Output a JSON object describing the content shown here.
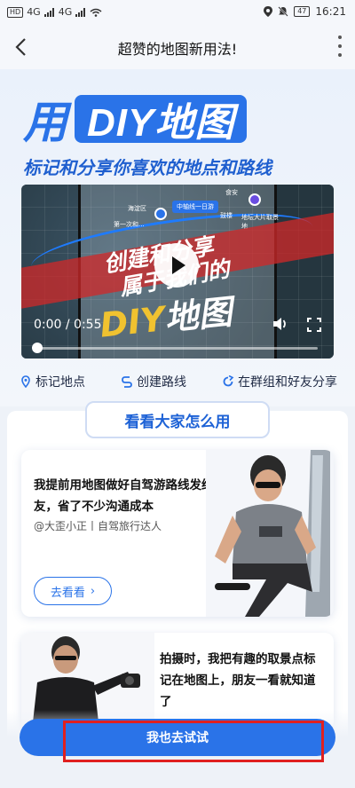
{
  "status_bar": {
    "hd": "HD",
    "net1": "4G",
    "net2": "4G",
    "battery": "47",
    "time": "16:21"
  },
  "nav": {
    "title": "超赞的地图新用法!"
  },
  "hero": {
    "title_prefix": "用",
    "title_main": "DIY地图",
    "subtitle": "标记和分享你喜欢的地点和路线"
  },
  "video": {
    "overlay_line1": "创建和分享",
    "overlay_line2": "属于我们的",
    "overlay_line3_a": "DIY",
    "overlay_line3_b": "地图",
    "map_tag": "中轴线一日游",
    "map_labels": [
      "海淀区",
      "第一次和...",
      "鼓楼",
      "食安",
      "地坛大片取景地"
    ],
    "time": "0:00 / 0:55",
    "progress": 0.0
  },
  "features": [
    {
      "icon": "location-pin-icon",
      "label": "标记地点"
    },
    {
      "icon": "route-icon",
      "label": "创建路线"
    },
    {
      "icon": "share-icon",
      "label": "在群组和好友分享"
    }
  ],
  "section": {
    "title": "看看大家怎么用"
  },
  "cards": [
    {
      "quote": "我提前用地图做好自驾游路线发给朋友，省了不少沟通成本",
      "author": "@大歪小正丨自驾旅行达人",
      "button": "去看看"
    },
    {
      "quote": "拍摄时，我把有趣的取景点标记在地图上，朋友一看就知道了"
    }
  ],
  "cta": {
    "label": "我也去试试"
  },
  "colors": {
    "accent": "#2a73e8",
    "highlight_box": "#e02020"
  }
}
